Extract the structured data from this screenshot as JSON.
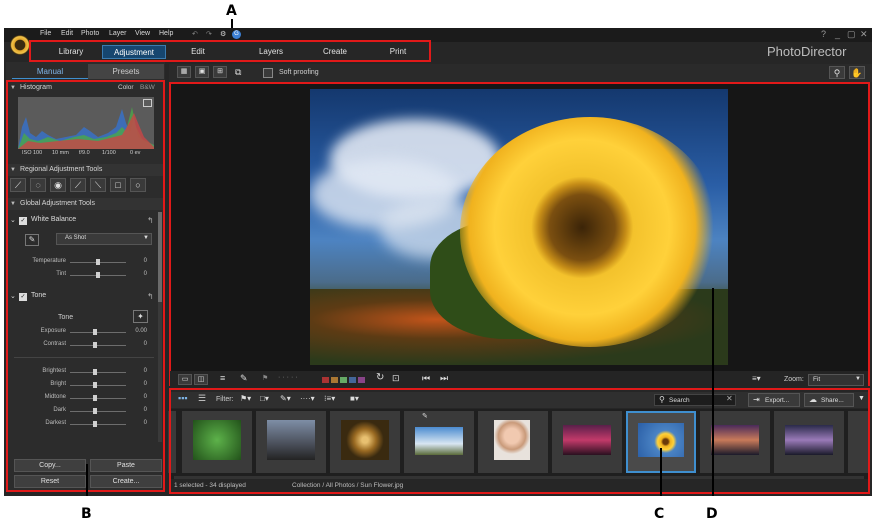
{
  "menu": [
    "File",
    "Edit",
    "Photo",
    "Layer",
    "View",
    "Help"
  ],
  "window_controls": [
    "?",
    "_",
    "▢",
    "✕"
  ],
  "tabs": [
    "Library",
    "Adjustment",
    "Edit",
    "Layers",
    "Create",
    "Print"
  ],
  "active_tab": "Adjustment",
  "brand": "PhotoDirector",
  "left": {
    "tabs": [
      "Manual",
      "Presets"
    ],
    "histogram": {
      "title": "Histogram",
      "color": "Color",
      "bw": "B&W",
      "info": [
        "ISO 100",
        "10 mm",
        "f/9.0",
        "1/100",
        "0 ev"
      ]
    },
    "regional_title": "Regional Adjustment Tools",
    "global_title": "Global Adjustment Tools",
    "white_balance": {
      "title": "White Balance",
      "preset": "As Shot",
      "sliders": [
        {
          "label": "Temperature",
          "value": "0",
          "pos": 0.5
        },
        {
          "label": "Tint",
          "value": "0",
          "pos": 0.5
        }
      ]
    },
    "tone": {
      "title": "Tone",
      "sub": "Tone",
      "sliders": [
        {
          "label": "Exposure",
          "value": "0.00",
          "pos": 0.45
        },
        {
          "label": "Contrast",
          "value": "0",
          "pos": 0.45
        }
      ],
      "sliders2": [
        {
          "label": "Brightest",
          "value": "0",
          "pos": 0.45
        },
        {
          "label": "Bright",
          "value": "0",
          "pos": 0.45
        },
        {
          "label": "Midtone",
          "value": "0",
          "pos": 0.45
        },
        {
          "label": "Dark",
          "value": "0",
          "pos": 0.45
        },
        {
          "label": "Darkest",
          "value": "0",
          "pos": 0.45
        }
      ]
    },
    "buttons": [
      "Copy...",
      "Paste",
      "Reset",
      "Create..."
    ]
  },
  "toolbar": {
    "soft_proofing": "Soft proofing"
  },
  "viewer_bar": {
    "zoom_label": "Zoom:",
    "zoom_value": "Fit"
  },
  "film_bar": {
    "filter": "Filter:",
    "search": "Search",
    "export": "Export...",
    "share": "Share..."
  },
  "status": {
    "count": "1 selected - 34 displayed",
    "path": "Collection / All Photos / Sun Flower.jpg"
  },
  "callouts": {
    "a": "A",
    "b": "B",
    "c": "C",
    "d": "D"
  },
  "colors": {
    "accent": "#16466f",
    "callout_red": "#e11919",
    "selected_thumb": "#3f8fcf"
  }
}
